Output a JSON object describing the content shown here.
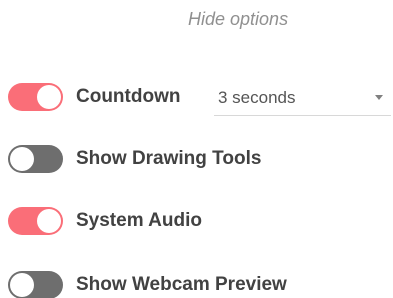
{
  "header": {
    "hide_options_label": "Hide options"
  },
  "options": {
    "countdown": {
      "label": "Countdown",
      "enabled": true
    },
    "drawing_tools": {
      "label": "Show Drawing Tools",
      "enabled": false
    },
    "system_audio": {
      "label": "System Audio",
      "enabled": true
    },
    "webcam_preview": {
      "label": "Show Webcam Preview",
      "enabled": false
    }
  },
  "countdown_select": {
    "value": "3 seconds",
    "icon": "caret-down-icon"
  },
  "colors": {
    "toggle_on": "#fa6e78",
    "toggle_off": "#6e6e6e",
    "label_text": "#424242",
    "link_text": "#909090"
  }
}
